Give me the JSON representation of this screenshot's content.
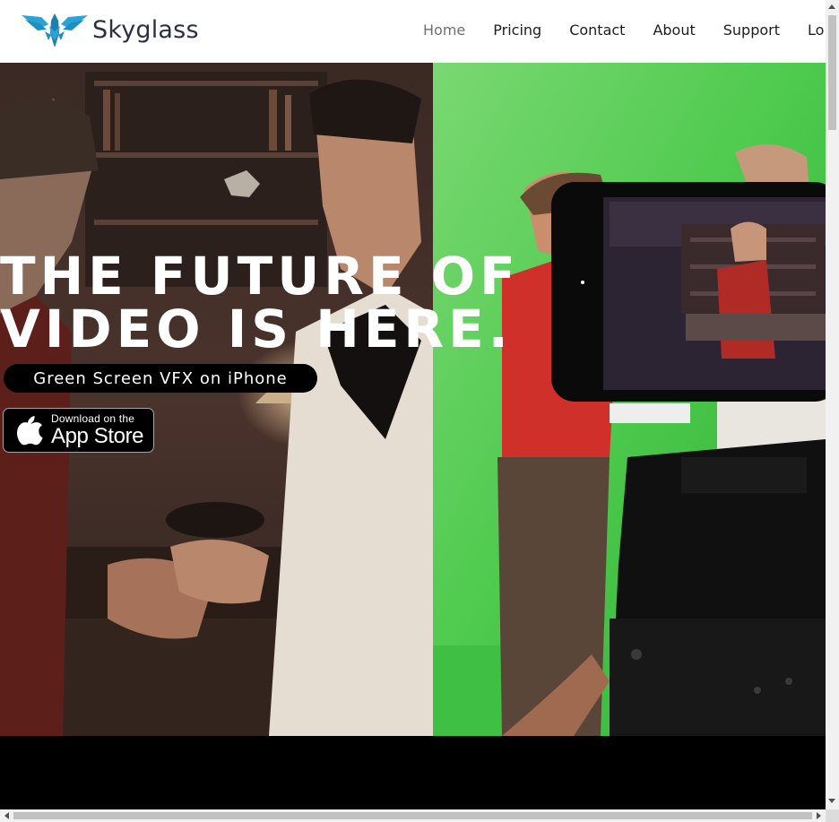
{
  "brand": {
    "name": "Skyglass",
    "logo_icon": "winged-bird-logo-icon",
    "accent_color": "#29a3d6",
    "text_color": "#2a2f45"
  },
  "nav": {
    "items": [
      {
        "label": "Home",
        "active": true
      },
      {
        "label": "Pricing",
        "active": false
      },
      {
        "label": "Contact",
        "active": false
      },
      {
        "label": "About",
        "active": false
      },
      {
        "label": "Support",
        "active": false
      },
      {
        "label": "Lo",
        "active": false
      }
    ]
  },
  "hero": {
    "headline_line1": "THE FUTURE OF",
    "headline_line2": "VIDEO IS HERE.",
    "tagline": "Green Screen VFX on iPhone",
    "green_screen_color": "#4cc94c",
    "app_store": {
      "small_text": "Download on the",
      "big_text": "App Store",
      "icon": "apple-icon"
    }
  }
}
